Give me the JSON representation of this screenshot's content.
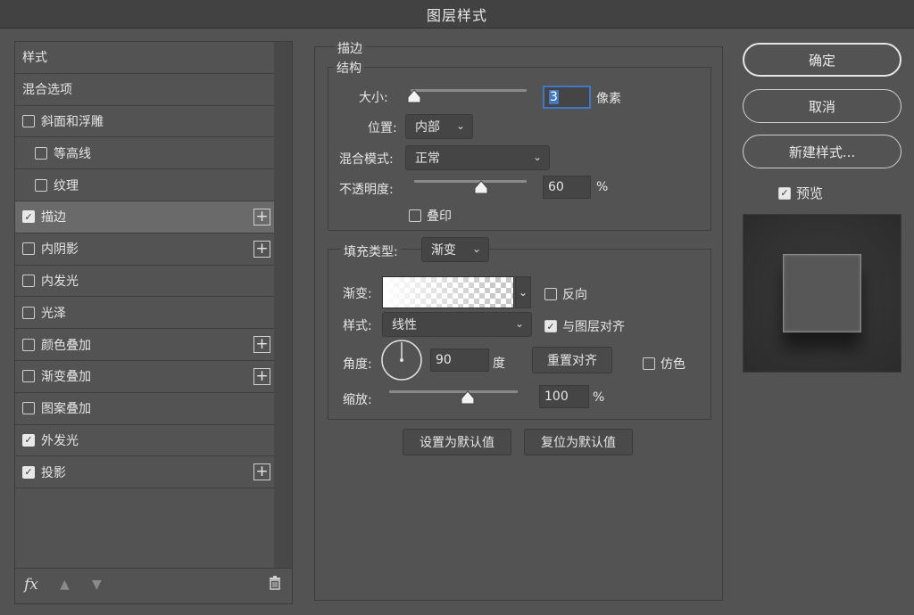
{
  "window": {
    "title": "图层样式"
  },
  "styles_list": {
    "items": [
      {
        "label": "样式",
        "type": "header"
      },
      {
        "label": "混合选项",
        "type": "header"
      },
      {
        "label": "斜面和浮雕",
        "checked": false,
        "plus": false,
        "indent": 0
      },
      {
        "label": "等高线",
        "checked": false,
        "plus": false,
        "indent": 1
      },
      {
        "label": "纹理",
        "checked": false,
        "plus": false,
        "indent": 1
      },
      {
        "label": "描边",
        "checked": true,
        "plus": true,
        "indent": 0,
        "selected": true
      },
      {
        "label": "内阴影",
        "checked": false,
        "plus": true,
        "indent": 0
      },
      {
        "label": "内发光",
        "checked": false,
        "plus": false,
        "indent": 0
      },
      {
        "label": "光泽",
        "checked": false,
        "plus": false,
        "indent": 0
      },
      {
        "label": "颜色叠加",
        "checked": false,
        "plus": true,
        "indent": 0
      },
      {
        "label": "渐变叠加",
        "checked": false,
        "plus": true,
        "indent": 0
      },
      {
        "label": "图案叠加",
        "checked": false,
        "plus": false,
        "indent": 0
      },
      {
        "label": "外发光",
        "checked": true,
        "plus": false,
        "indent": 0
      },
      {
        "label": "投影",
        "checked": true,
        "plus": true,
        "indent": 0
      }
    ],
    "footer": {
      "fx_label": "fx",
      "up_icon": "arrow-up-icon",
      "down_icon": "arrow-down-icon",
      "trash_icon": "trash-icon"
    }
  },
  "stroke": {
    "section_title": "描边",
    "structure_title": "结构",
    "size_label": "大小:",
    "size_value": "3",
    "size_unit": "像素",
    "size_slider_fraction": 0.0,
    "position_label": "位置:",
    "position_value": "内部",
    "blend_label": "混合模式:",
    "blend_value": "正常",
    "opacity_label": "不透明度:",
    "opacity_value": "60",
    "opacity_unit": "%",
    "opacity_slider_fraction": 0.6,
    "overprint_label": "叠印",
    "overprint_checked": false
  },
  "fill": {
    "type_label": "填充类型:",
    "type_value": "渐变",
    "gradient_label": "渐变:",
    "reverse_label": "反向",
    "reverse_checked": false,
    "style_label": "样式:",
    "style_value": "线性",
    "align_label": "与图层对齐",
    "align_checked": true,
    "angle_label": "角度:",
    "angle_value": "90",
    "angle_unit": "度",
    "reset_align_label": "重置对齐",
    "dither_label": "仿色",
    "dither_checked": false,
    "scale_label": "缩放:",
    "scale_value": "100",
    "scale_unit": "%",
    "scale_slider_fraction": 0.62
  },
  "defaults": {
    "make_default_label": "设置为默认值",
    "reset_default_label": "复位为默认值"
  },
  "actions": {
    "ok_label": "确定",
    "cancel_label": "取消",
    "new_style_label": "新建样式...",
    "preview_label": "预览",
    "preview_checked": true
  },
  "colors": {
    "bg": "#535353",
    "focus": "#3e78c6"
  }
}
